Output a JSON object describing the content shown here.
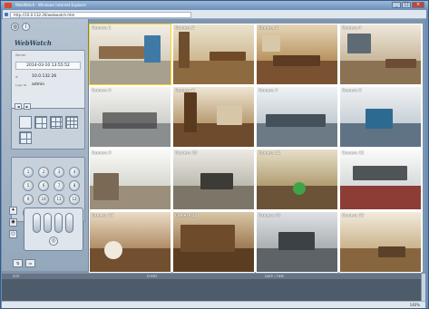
{
  "window": {
    "title": "WebWatch - Windows Internet Explorer",
    "url": "http://10.0.132.26/webwatch.htm"
  },
  "sidebar": {
    "logo": "WebWatch",
    "top_icons": [
      "globe-icon",
      "info-icon"
    ],
    "info": {
      "section_label": "Server",
      "datetime": "2014-03-10 13:55:52",
      "ip_label": "IP",
      "ip": "10.0.132.26",
      "user_label": "Login ID",
      "user": "admin"
    },
    "division_tabs": [
      "◄",
      "►"
    ],
    "division_layouts": [
      "1x1",
      "2x2",
      "3x3",
      "4x4",
      "4x4b"
    ],
    "keypad": [
      "1",
      "2",
      "3",
      "4",
      "5",
      "6",
      "7",
      "8",
      "9",
      "10",
      "11",
      "12",
      "13",
      "14",
      "15",
      "16"
    ],
    "ptz_side": [
      "✦",
      "◉",
      "○"
    ],
    "ptz_center": "◎",
    "bottom_tools": [
      "⇅",
      "▭"
    ]
  },
  "cameras": [
    {
      "label": "Camera 1"
    },
    {
      "label": "Camera 2"
    },
    {
      "label": "Camera 3"
    },
    {
      "label": "Camera 4"
    },
    {
      "label": "Camera 5"
    },
    {
      "label": "Camera 6"
    },
    {
      "label": "Camera 7"
    },
    {
      "label": "Camera 8"
    },
    {
      "label": "Camera 9"
    },
    {
      "label": "Camera 10"
    },
    {
      "label": "Camera 11"
    },
    {
      "label": "Camera 12"
    },
    {
      "label": "Camera 13"
    },
    {
      "label": "Camera 14"
    },
    {
      "label": "Camera 15"
    },
    {
      "label": "Camera 16"
    }
  ],
  "eventlog": {
    "columns": [
      "SITE",
      "EVENT",
      "DATE / TIME"
    ]
  },
  "statusbar": {
    "zoom": "140%"
  }
}
